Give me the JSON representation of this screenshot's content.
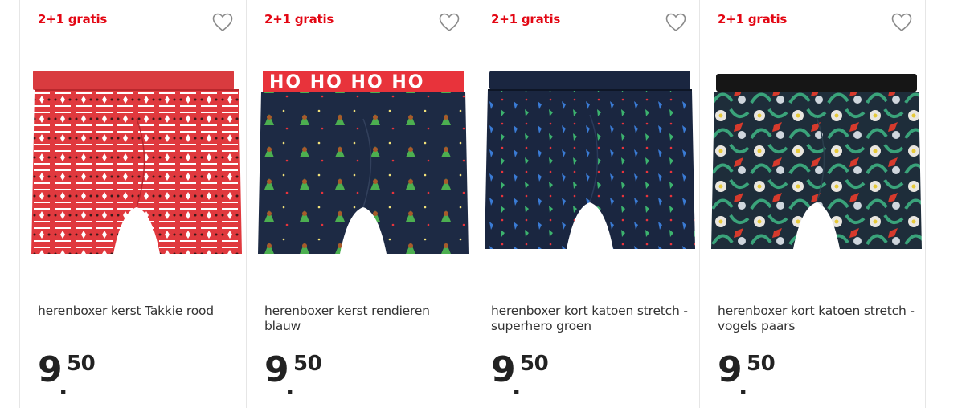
{
  "products": [
    {
      "promo": "2+1 gratis",
      "title": "herenboxer kerst Takkie rood",
      "price_main": "9",
      "price_cents": "50",
      "favorite_icon": "heart-outline-icon",
      "pattern": "nordic-dog",
      "colors": {
        "body": "#e0393e",
        "waistband": "#d93b3f",
        "accent": "#ffffff",
        "dark": "#3a1a1a"
      }
    },
    {
      "promo": "2+1 gratis",
      "title": "herenboxer kerst rendieren blauw",
      "price_main": "9",
      "price_cents": "50",
      "favorite_icon": "heart-outline-icon",
      "pattern": "reindeer",
      "waistband_text": "HO HO HO HO",
      "colors": {
        "body": "#1d2a44",
        "waistband": "#e8333b",
        "accent": "#a85b2a",
        "dark": "#4caf50"
      }
    },
    {
      "promo": "2+1 gratis",
      "title": "herenboxer kort katoen stretch - superhero groen",
      "price_main": "9",
      "price_cents": "50",
      "favorite_icon": "heart-outline-icon",
      "pattern": "superhero",
      "colors": {
        "body": "#1a2640",
        "waistband": "#1a2640",
        "accent": "#3a7bd5",
        "dark": "#3cb36e"
      }
    },
    {
      "promo": "2+1 gratis",
      "title": "herenboxer kort katoen stretch - vogels paars",
      "price_main": "9",
      "price_cents": "50",
      "favorite_icon": "heart-outline-icon",
      "pattern": "tropical-birds",
      "colors": {
        "body": "#1e2d3a",
        "waistband": "#161616",
        "accent": "#d63a2c",
        "dark": "#3aa37a"
      }
    }
  ],
  "colors": {
    "promo_red": "#e30613",
    "divider": "#e6e6e6",
    "text": "#333333"
  }
}
